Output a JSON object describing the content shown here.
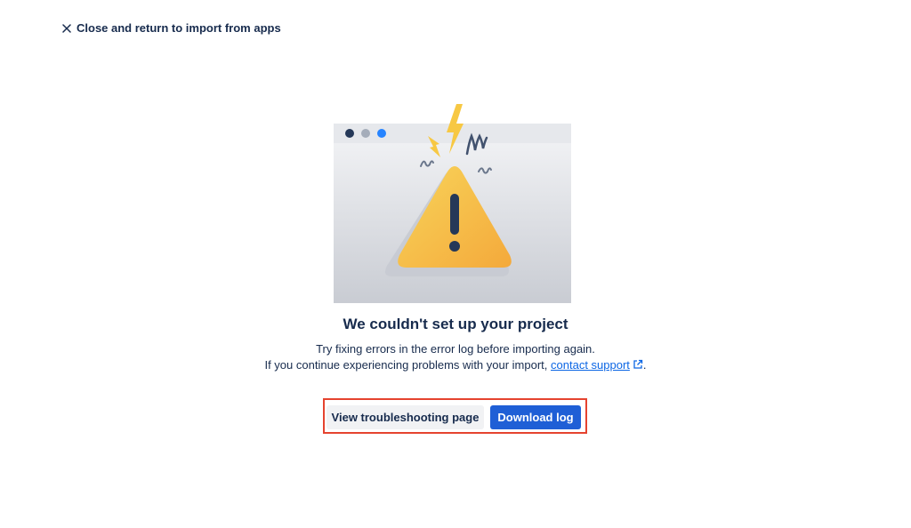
{
  "header": {
    "close_label": "Close and return to import from apps"
  },
  "illustration": {
    "name": "warning-illustration",
    "window_dot_colors": [
      "#253858",
      "#a5adba",
      "#2684ff"
    ],
    "accent_color": "#f7c843"
  },
  "message": {
    "title": "We couldn't set up your project",
    "line1": "Try fixing errors in the error log before importing again.",
    "line2_prefix": "If you continue experiencing problems with your import, ",
    "link_text": "contact support",
    "line2_suffix": "."
  },
  "actions": {
    "secondary_label": "View troubleshooting page",
    "primary_label": "Download log",
    "primary_color": "#1f5fd6",
    "highlight_color": "#e5432f"
  }
}
